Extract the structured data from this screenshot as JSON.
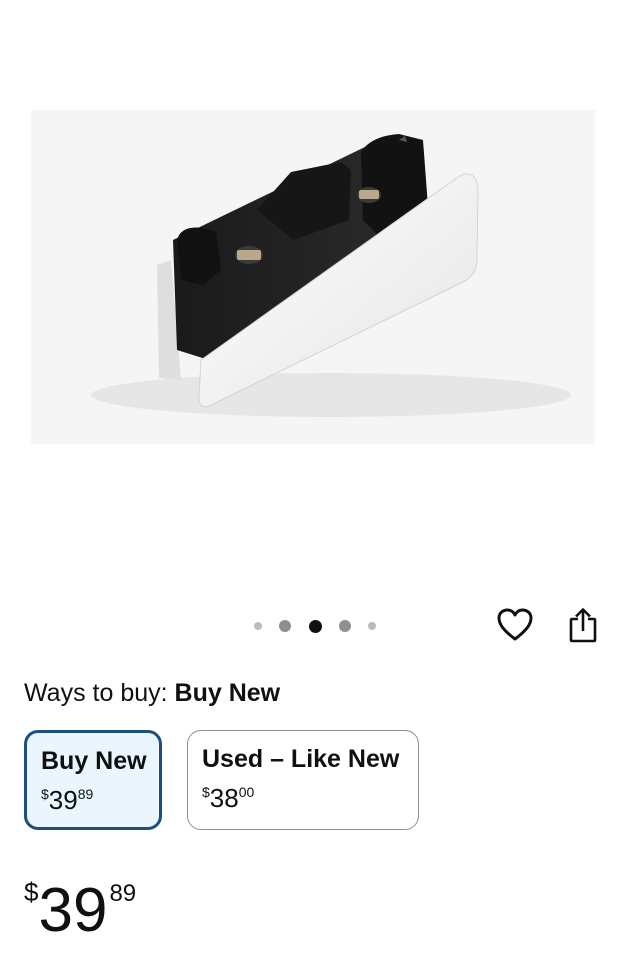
{
  "product": {
    "image_alt": "Dual charging station for game controllers"
  },
  "gallery": {
    "page_count": 5,
    "active_index": 2
  },
  "actions": {
    "favorite_icon": "heart-icon",
    "share_icon": "share-icon"
  },
  "ways_to_buy": {
    "prefix": "Ways to buy:",
    "selected": "Buy New"
  },
  "options": [
    {
      "label": "Buy New",
      "currency": "$",
      "whole": "39",
      "fraction": "89",
      "selected": true
    },
    {
      "label": "Used – Like New",
      "currency": "$",
      "whole": "38",
      "fraction": "00",
      "selected": false
    }
  ],
  "price": {
    "currency": "$",
    "whole": "39",
    "fraction": "89"
  },
  "colors": {
    "selected_border": "#1f4e7c",
    "selected_fill": "#eaf5fd",
    "text": "#0f1111"
  }
}
